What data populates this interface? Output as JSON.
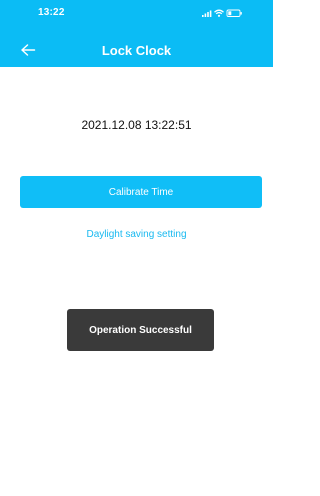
{
  "status_bar": {
    "time": "13:22"
  },
  "header": {
    "title": "Lock Clock",
    "back_icon": "back-arrow-icon"
  },
  "main": {
    "datetime": "2021.12.08 13:22:51",
    "calibrate_label": "Calibrate Time",
    "daylight_link": "Daylight saving setting"
  },
  "toast": {
    "message": "Operation Successful"
  },
  "colors": {
    "header": "#0bbcf5",
    "button": "#10bef7",
    "link": "#18b9f0",
    "toast": "#3a3a3a"
  }
}
